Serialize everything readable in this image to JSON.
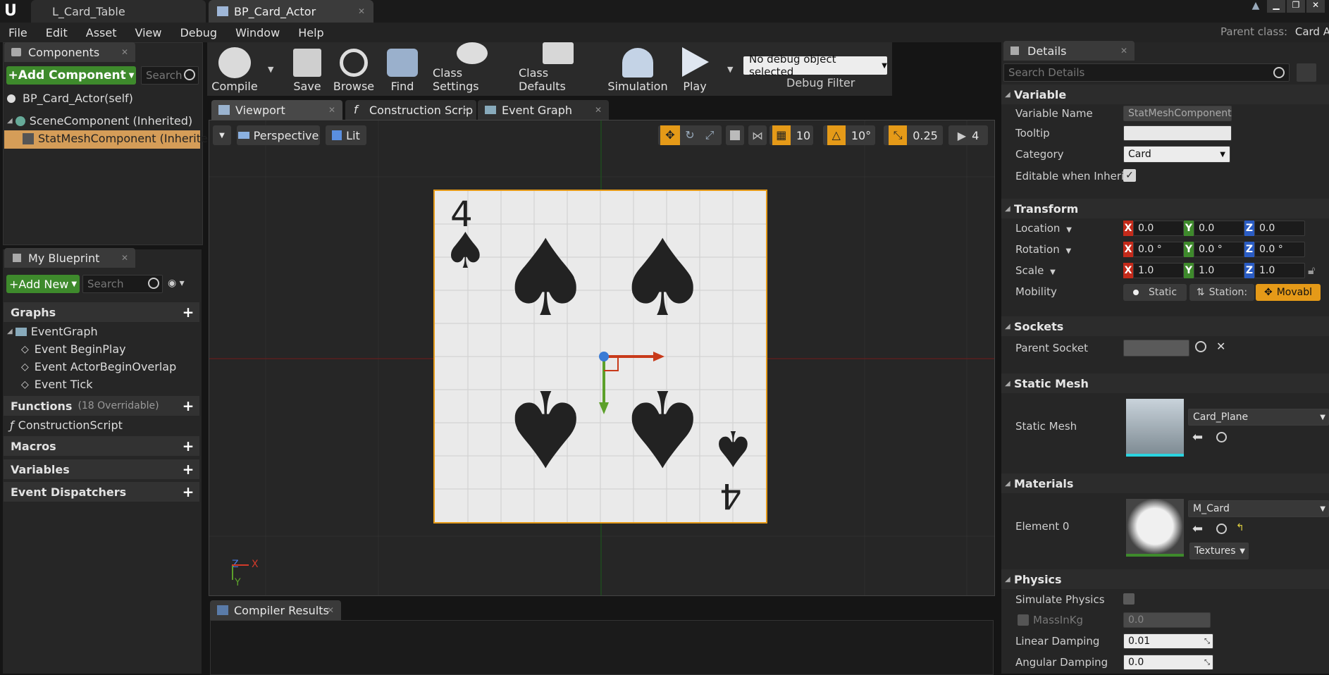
{
  "tabs": [
    {
      "label": "L_Card_Table"
    },
    {
      "label": "BP_Card_Actor"
    }
  ],
  "menu": [
    "File",
    "Edit",
    "Asset",
    "View",
    "Debug",
    "Window",
    "Help"
  ],
  "parent_class": {
    "label": "Parent class:",
    "value": "Card Ac"
  },
  "components": {
    "title": "Components",
    "add_label": "+Add Component",
    "search_placeholder": "Search",
    "items": [
      "BP_Card_Actor(self)",
      "SceneComponent (Inherited)",
      "StatMeshComponent (Inherited)"
    ]
  },
  "my_blueprint": {
    "title": "My Blueprint",
    "add_label": "+Add New",
    "search_placeholder": "Search",
    "graphs": "Graphs",
    "event_graph": "EventGraph",
    "events": [
      "Event BeginPlay",
      "Event ActorBeginOverlap",
      "Event Tick"
    ],
    "functions": "Functions",
    "functions_note": "(18 Overridable)",
    "construction": "ConstructionScript",
    "macros": "Macros",
    "variables": "Variables",
    "dispatchers": "Event Dispatchers"
  },
  "toolbar": {
    "compile": "Compile",
    "save": "Save",
    "browse": "Browse",
    "find": "Find",
    "class_settings": "Class Settings",
    "class_defaults": "Class Defaults",
    "simulation": "Simulation",
    "play": "Play",
    "debug_object": "No debug object selected",
    "debug_filter": "Debug Filter"
  },
  "editor_tabs": [
    "Viewport",
    "Construction Scrip",
    "Event Graph"
  ],
  "viewport": {
    "perspective": "Perspective",
    "lit": "Lit",
    "grid_snap": "10",
    "rot_snap": "10°",
    "scale_snap": "0.25",
    "cam_speed": "4",
    "card_rank": "4",
    "axis_x": "X",
    "axis_y": "Y",
    "axis_z": "Z"
  },
  "compiler_results": {
    "title": "Compiler Results"
  },
  "details": {
    "title": "Details",
    "search_placeholder": "Search Details",
    "variable": {
      "title": "Variable",
      "name_label": "Variable Name",
      "name_value": "StatMeshComponent",
      "tooltip_label": "Tooltip",
      "category_label": "Category",
      "category_value": "Card",
      "editable_label": "Editable when Inherite"
    },
    "transform": {
      "title": "Transform",
      "location_label": "Location",
      "rotation_label": "Rotation",
      "scale_label": "Scale",
      "mobility_label": "Mobility",
      "location": [
        "0.0",
        "0.0",
        "0.0"
      ],
      "rotation": [
        "0.0 °",
        "0.0 °",
        "0.0 °"
      ],
      "scale": [
        "1.0",
        "1.0",
        "1.0"
      ],
      "mobility": [
        "Static",
        "Station:",
        "Movabl"
      ]
    },
    "sockets": {
      "title": "Sockets",
      "parent_label": "Parent Socket"
    },
    "static_mesh": {
      "title": "Static Mesh",
      "label": "Static Mesh",
      "value": "Card_Plane"
    },
    "materials": {
      "title": "Materials",
      "label": "Element 0",
      "value": "M_Card",
      "textures": "Textures"
    },
    "physics": {
      "title": "Physics",
      "simulate_label": "Simulate Physics",
      "mass_label": "MassInKg",
      "mass_value": "0.0",
      "linear_label": "Linear Damping",
      "linear_value": "0.01",
      "angular_label": "Angular Damping",
      "angular_value": "0.0"
    }
  },
  "colors": {
    "accent": "#e59a18",
    "green": "#3e8a2c",
    "bg": "#151515"
  }
}
